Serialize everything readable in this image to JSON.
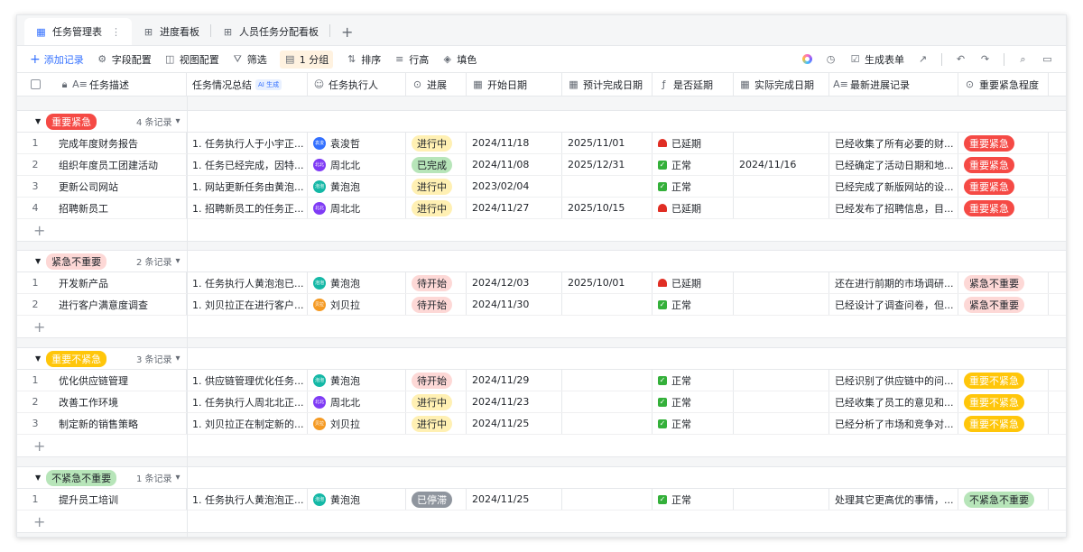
{
  "tabs": [
    {
      "label": "任务管理表",
      "active": true
    },
    {
      "label": "进度看板",
      "active": false
    },
    {
      "label": "人员任务分配看板",
      "active": false
    }
  ],
  "toolbar": {
    "add": "添加记录",
    "field": "字段配置",
    "view": "视图配置",
    "filter": "筛选",
    "group": "1 分组",
    "sort": "排序",
    "rowheight": "行高",
    "fill": "填色",
    "form": "生成表单"
  },
  "headers": [
    "任务描述",
    "任务情况总结",
    "任务执行人",
    "进展",
    "开始日期",
    "预计完成日期",
    "是否延期",
    "实际完成日期",
    "最新进展记录",
    "重要紧急程度"
  ],
  "ai_tag": "AI 生成",
  "colors": {
    "red_tag_bg": "#f54a45",
    "red_tag_fg": "#ffffff",
    "pink_tag_bg": "#fdd8d6",
    "pink_tag_fg": "#1f2329",
    "yellow_tag_bg": "#ffc60a",
    "yellow_tag_fg": "#ffffff",
    "green_tag_bg": "#b7e5b9",
    "green_tag_fg": "#1f2329",
    "status_inprogress": "#fff0b3",
    "status_done": "#b7e5b9",
    "status_todo": "#fdd8d6",
    "status_stalled": "#8f959e",
    "avatar_blue": "#3370ff",
    "avatar_purple": "#7f3bf5",
    "avatar_teal": "#14b8a6",
    "avatar_orange": "#f59a23"
  },
  "groups": [
    {
      "label": "重要紧急",
      "count": "4 条记录",
      "tag": "red",
      "rows": [
        {
          "idx": "1",
          "desc": "完成年度财务报告",
          "summary": "1. 任务执行人于小宇正...",
          "person": "袁浚哲",
          "avatar": "blue",
          "avatar_text": "袁浚",
          "status": "进行中",
          "status_type": "inprogress",
          "start": "2024/11/18",
          "due": "2025/11/01",
          "delay": "已延期",
          "delay_type": "late",
          "actual": "",
          "note": "已经收集了所有必要的财...",
          "level": "重要紧急"
        },
        {
          "idx": "2",
          "desc": "组织年度员工团建活动",
          "summary": "1. 任务已经完成，因特...",
          "person": "周北北",
          "avatar": "purple",
          "avatar_text": "北北",
          "status": "已完成",
          "status_type": "done",
          "start": "2024/11/08",
          "due": "2025/12/31",
          "delay": "正常",
          "delay_type": "ok",
          "actual": "2024/11/16",
          "note": "已经确定了活动日期和地...",
          "level": "重要紧急"
        },
        {
          "idx": "3",
          "desc": "更新公司网站",
          "summary": "1. 网站更新任务由黄泡...",
          "person": "黄泡泡",
          "avatar": "teal",
          "avatar_text": "泡泡",
          "status": "进行中",
          "status_type": "inprogress",
          "start": "2023/02/04",
          "due": "",
          "delay": "正常",
          "delay_type": "ok",
          "actual": "",
          "note": "已经完成了新版网站的设...",
          "level": "重要紧急"
        },
        {
          "idx": "4",
          "desc": "招聘新员工",
          "summary": "1. 招聘新员工的任务正...",
          "person": "周北北",
          "avatar": "purple",
          "avatar_text": "北北",
          "status": "进行中",
          "status_type": "inprogress",
          "start": "2024/11/27",
          "due": "2025/10/15",
          "delay": "已延期",
          "delay_type": "late",
          "actual": "",
          "note": "已经发布了招聘信息，目...",
          "level": "重要紧急"
        }
      ]
    },
    {
      "label": "紧急不重要",
      "count": "2 条记录",
      "tag": "pink",
      "rows": [
        {
          "idx": "1",
          "desc": "开发新产品",
          "summary": "1. 任务执行人黄泡泡已...",
          "person": "黄泡泡",
          "avatar": "teal",
          "avatar_text": "泡泡",
          "status": "待开始",
          "status_type": "todo",
          "start": "2024/12/03",
          "due": "2025/10/01",
          "delay": "已延期",
          "delay_type": "late",
          "actual": "",
          "note": "还在进行前期的市场调研...",
          "level": "紧急不重要"
        },
        {
          "idx": "2",
          "desc": "进行客户满意度调查",
          "summary": "1. 刘贝拉正在进行客户...",
          "person": "刘贝拉",
          "avatar": "orange",
          "avatar_text": "贝拉",
          "status": "待开始",
          "status_type": "todo",
          "start": "2024/11/30",
          "due": "",
          "delay": "正常",
          "delay_type": "ok",
          "actual": "",
          "note": "已经设计了调查问卷，但...",
          "level": "紧急不重要"
        }
      ]
    },
    {
      "label": "重要不紧急",
      "count": "3 条记录",
      "tag": "yellow",
      "rows": [
        {
          "idx": "1",
          "desc": "优化供应链管理",
          "summary": "1. 供应链管理优化任务...",
          "person": "黄泡泡",
          "avatar": "teal",
          "avatar_text": "泡泡",
          "status": "待开始",
          "status_type": "todo",
          "start": "2024/11/29",
          "due": "",
          "delay": "正常",
          "delay_type": "ok",
          "actual": "",
          "note": "已经识别了供应链中的问...",
          "level": "重要不紧急"
        },
        {
          "idx": "2",
          "desc": "改善工作环境",
          "summary": "1. 任务执行人周北北正...",
          "person": "周北北",
          "avatar": "purple",
          "avatar_text": "北北",
          "status": "进行中",
          "status_type": "inprogress",
          "start": "2024/11/23",
          "due": "",
          "delay": "正常",
          "delay_type": "ok",
          "actual": "",
          "note": "已经收集了员工的意见和...",
          "level": "重要不紧急"
        },
        {
          "idx": "3",
          "desc": "制定新的销售策略",
          "summary": "1. 刘贝拉正在制定新的...",
          "person": "刘贝拉",
          "avatar": "orange",
          "avatar_text": "贝拉",
          "status": "进行中",
          "status_type": "inprogress",
          "start": "2024/11/25",
          "due": "",
          "delay": "正常",
          "delay_type": "ok",
          "actual": "",
          "note": "已经分析了市场和竞争对...",
          "level": "重要不紧急"
        }
      ]
    },
    {
      "label": "不紧急不重要",
      "count": "1 条记录",
      "tag": "green",
      "rows": [
        {
          "idx": "1",
          "desc": "提升员工培训",
          "summary": "1. 任务执行人黄泡泡正...",
          "person": "黄泡泡",
          "avatar": "teal",
          "avatar_text": "泡泡",
          "status": "已停滞",
          "status_type": "stalled",
          "start": "2024/11/25",
          "due": "",
          "delay": "正常",
          "delay_type": "ok",
          "actual": "",
          "note": "处理其它更高优的事情，...",
          "level": "不紧急不重要"
        }
      ]
    }
  ]
}
